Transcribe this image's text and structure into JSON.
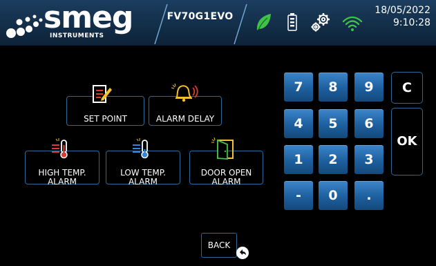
{
  "header": {
    "brand": "smeg",
    "brand_sub": "INSTRUMENTS",
    "model": "FV70G1EVO",
    "date": "18/05/2022",
    "time": "9:10:28",
    "icons": [
      "leaf-icon",
      "battery-icon",
      "settings-gears-icon",
      "wifi-icon"
    ],
    "accent_color": "#2e6a95",
    "leaf_color": "#3ec24a"
  },
  "options": {
    "set_point": "SET POINT",
    "alarm_delay": "ALARM DELAY",
    "high_temp_line1": "HIGH TEMP.",
    "high_temp_line2": "ALARM",
    "low_temp_line1": "LOW TEMP.",
    "low_temp_line2": "ALARM",
    "door_open_line1": "DOOR OPEN",
    "door_open_line2": "ALARM"
  },
  "keypad": {
    "k7": "7",
    "k8": "8",
    "k9": "9",
    "k4": "4",
    "k5": "5",
    "k6": "6",
    "k1": "1",
    "k2": "2",
    "k3": "3",
    "minus": "-",
    "k0": "0",
    "dot": ".",
    "clear": "C",
    "ok": "OK"
  },
  "back": {
    "label": "BACK"
  }
}
